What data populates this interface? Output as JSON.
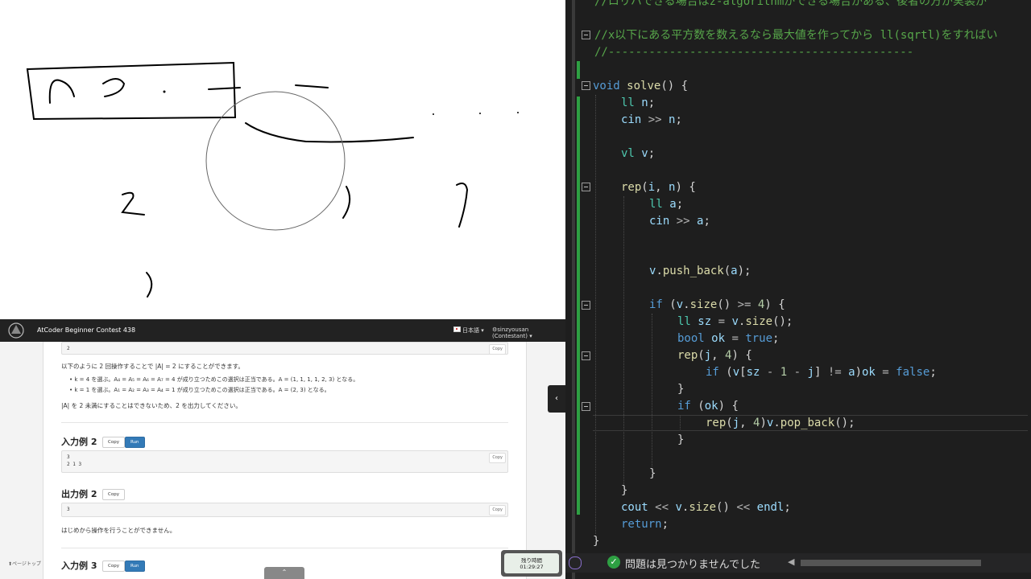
{
  "browser": {
    "navbar": {
      "contest_title": "AtCoder Beginner Contest 438",
      "language": "日本語",
      "user": "sinzyousan (Contestant)"
    },
    "sample1_output": {
      "value": "2",
      "copy": "Copy"
    },
    "explanation": {
      "intro": "以下のように 2 回操作することで |A| = 2 にすることができます。",
      "bullet1": "k = 4 を選ぶ。A₄ = A₅ = A₆ = A₇ = 4 が成り立つためこの選択は正当である。A = (1, 1, 1, 1, 2, 3) となる。",
      "bullet2": "k = 1 を選ぶ。A₁ = A₂ = A₃ = A₄ = 1 が成り立つためこの選択は正当である。A = (2, 3) となる。",
      "conclusion": "|A| を 2 未満にすることはできないため、2 を出力してください。"
    },
    "sample_input2": {
      "heading": "入力例 2",
      "copy": "Copy",
      "run": "Run",
      "line1": "3",
      "line2": "2 1 3"
    },
    "sample_output2": {
      "heading": "出力例 2",
      "copy": "Copy",
      "value": "3"
    },
    "note2": "はじめから操作を行うことができません。",
    "sample_input3": {
      "heading": "入力例 3",
      "copy": "Copy",
      "run": "Run"
    },
    "page_top": "ページトップ",
    "timer": {
      "label": "残り時間",
      "value": "01:29:27"
    }
  },
  "editor": {
    "comment_top": "//ロリハできる場合はz-algorithmができる場合がある、後者の方が実装が",
    "comment_sqrt": "//x以下にある平方数を数えるなら最大値を作ってから ll(sqrtl)をすればい",
    "comment_rule": "//---------------------------------------------",
    "status_message": "問題は見つかりませんでした"
  }
}
